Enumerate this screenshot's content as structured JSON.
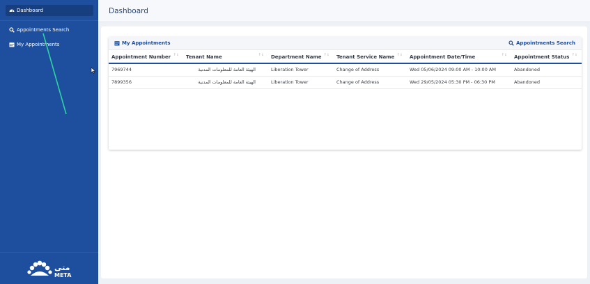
{
  "sidebar": {
    "items": [
      {
        "label": "Dashboard",
        "icon": "dashboard-icon",
        "active": true
      },
      {
        "label": "Appointments Search",
        "icon": "search-icon",
        "active": false
      },
      {
        "label": "My Appointments",
        "icon": "calendar-icon",
        "active": false
      }
    ],
    "logo": {
      "arabic": "متى",
      "latin": "META"
    }
  },
  "header": {
    "title": "Dashboard"
  },
  "card": {
    "title": "My Appointments",
    "title_icon": "calendar-icon",
    "link_label": "Appointments Search",
    "link_icon": "search-icon"
  },
  "table": {
    "columns": [
      "Appointment Number",
      "Tenant Name",
      "Department Name",
      "Tenant Service Name",
      "Appointment Date/Time",
      "Appointment Status"
    ],
    "rows": [
      [
        "7969744",
        "الهيئة العامة للمعلومات المدنية",
        "Liberation Tower",
        "Change of Address",
        "Wed 05/06/2024 09:00 AM - 10:00 AM",
        "Abandoned"
      ],
      [
        "7899356",
        "الهيئة العامة للمعلومات المدنية",
        "Liberation Tower",
        "Change of Address",
        "Wed 29/05/2024 05:30 PM - 06:30 PM",
        "Abandoned"
      ]
    ]
  },
  "colors": {
    "sidebar": "#1d4f9e",
    "accent": "#1d4f9e",
    "annotation_line": "#2fd3a2"
  }
}
